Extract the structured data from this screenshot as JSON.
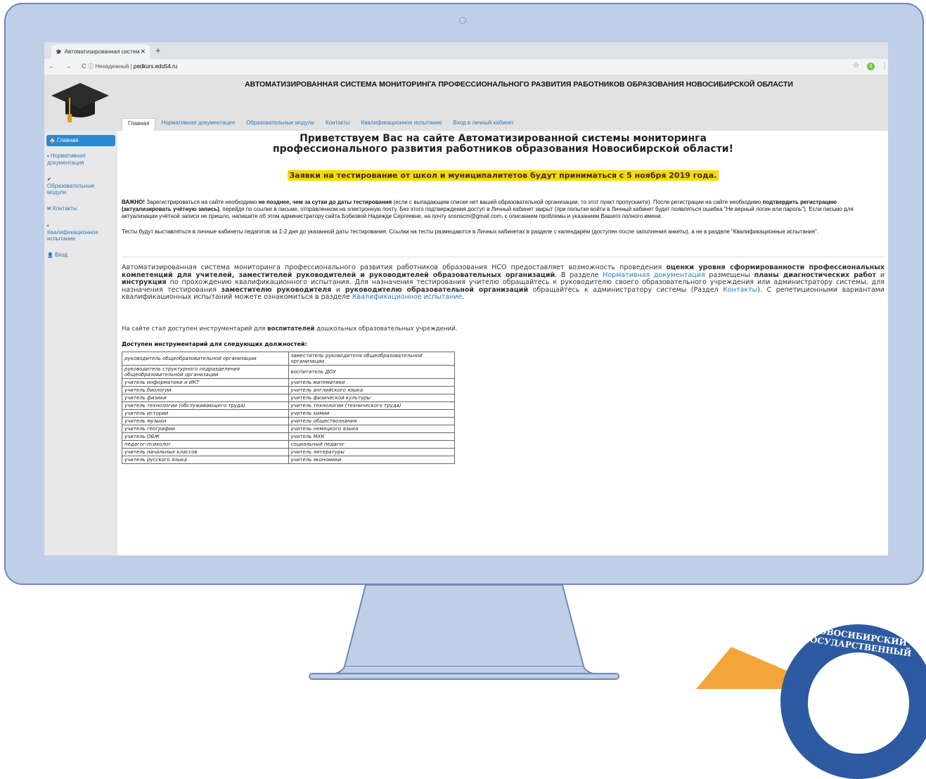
{
  "browser": {
    "tab_title": "Автоматизированная систем",
    "tab_close": "✕",
    "new_tab": "+",
    "nav_icons": "← → C",
    "security": "ⓘ Ненадежный",
    "url": "pedkurs.edu54.ru",
    "star": "☆",
    "extension": "0",
    "menu": "⋮"
  },
  "header": {
    "title": "АВТОМАТИЗИРОВАННАЯ СИСТЕМА МОНИТОРИНГА ПРОФЕССИОНАЛЬНОГО РАЗВИТИЯ РАБОТНИКОВ ОБРАЗОВАНИЯ НОВОСИБИРСКОЙ ОБЛАСТИ"
  },
  "topnav": {
    "items": [
      "Главная",
      "Нормативная документация",
      "Образовательные модули",
      "Контакты",
      "Квалификационное испытание",
      "Вход в личный кабинет"
    ]
  },
  "sidebar": {
    "items": [
      {
        "icon": "🏠",
        "label": "Главная"
      },
      {
        "icon": "▪",
        "label": "Нормативная документация"
      },
      {
        "icon": "✔",
        "label": "Образовательные модули"
      },
      {
        "icon": "✉",
        "label": "Контакты"
      },
      {
        "icon": "▪",
        "label": "Квалификационное испытание"
      },
      {
        "icon": "👤",
        "label": "Вход"
      }
    ]
  },
  "main": {
    "welcome_line1": "Приветствуем Вас на сайте Автоматизированной системы мониторинга",
    "welcome_line2": "профессионального развития работников образования Новосибирской области!",
    "banner": "Заявки на тестирование от школ и муниципалитетов будут приниматься с 5 ноября 2019 года.",
    "important": {
      "lead": "ВАЖНО!",
      "t1": " Зарегистрироваться на сайте необходимо ",
      "b1": "не позднее,  чем за сутки до даты тестирования",
      "t2": " (если с выпадающем списке нет вашей образовательной организации, то этот пункт пропускаете). После регистрации на сайте необходимо ",
      "b2": "подтвердить регистрацию (актуализировать учётную запись)",
      "t3": ", перейдя по  ссылке в письме, отправленном на электронную почту. Без этого подтверждения доступ в Личный кабинет закрыт (при попытке войти в Личный кабинет будет появляться ошибка \"Не верный логин или пароль\"). Если письмо для актуализации учётной записи не пришло, напишите об этом администратору сайта Бобковой Надежде Сергеевне, на почту snsnscm@gmail.com, с описанием проблемы и указанием Вашего полного имени."
    },
    "tests_note": "Тесты будут выставляться в личные кабинеты педагогов за 1-2 дня до указанной даты тестирования. Ссылки на тесты размещаются в Личных кабинетах в разделе с календарём (доступен после заполнения анкеты), а не в разделе \"Квалификационные испытания\".",
    "about": {
      "t1": "Автоматизированная система мониторинга профессионального развития работников образования НСО предоставляет возможность проведения ",
      "b1": "оценки уровня сформированности профессиональных компетенций для учителей, заместителей руководителей и руководителей образовательных организаций",
      "t2": ". В разделе ",
      "l1": "Нормативная документация",
      "t3": " размещены ",
      "b2": "планы диагностических работ",
      "t4": " и ",
      "b3": "инструкция",
      "t5": " по прохождению квалификационного испытания. Для назначения тестирования учителю обращайтесь к руководителю своего образовательного учреждения или администратору системы, для назначения тестирования ",
      "b4": "заместителю руководителя",
      "t6": " и ",
      "b5": "руководителю образовательной организаций",
      "t7": " обращайтесь к  администратору системы (Раздел ",
      "l2": "Контакты",
      "t8": "). С репетиционными вариантами квалификационных испытаний можете ознакомиться в разделе ",
      "l3": "Квалификационное испытание",
      "t9": "."
    },
    "tools": {
      "t1": "На сайте стал доступен инструментарий для ",
      "b1": "воспитателей",
      "t2": " дошкольных образовательных учреждений."
    },
    "positions_heading": "Доступен инструментарий для следующих должностей:",
    "positions": [
      [
        "руководитель общеобразовательной организации",
        "заместитель руководителя общеобразовательной организации"
      ],
      [
        "руководитель структурного подразделения общеобразовательной организации",
        "воспитатель ДОУ"
      ],
      [
        "учитель информатики и ИКТ",
        "учитель математики"
      ],
      [
        "учитель биологии",
        "учитель английского языка"
      ],
      [
        "учитель физики",
        "учитель физической культуры"
      ],
      [
        "учитель технологии (обслуживающего труда)",
        "учитель технологии (технического труда)"
      ],
      [
        "учитель истории",
        "учитель химии"
      ],
      [
        "учитель музыки",
        "учитель обществознания"
      ],
      [
        "учитель географии",
        "учитель немецкого языка"
      ],
      [
        "учитель ОБЖ",
        "учитель МХК"
      ],
      [
        "педагог-психолог",
        "социальный педагог"
      ],
      [
        "учитель начальных классов",
        "учитель литературы"
      ],
      [
        "учитель русского языка",
        "учитель экономики"
      ]
    ]
  },
  "logo": {
    "seal_text": "НОВОСИБИРСКИЙ ГОСУДАРСТВЕННЫЙ"
  },
  "colors": {
    "frame": "#c0cfe8",
    "frame_border": "#6f88b6",
    "link": "#2a7ab8",
    "active_nav": "#2a8ad0",
    "highlight": "#ffd800"
  }
}
